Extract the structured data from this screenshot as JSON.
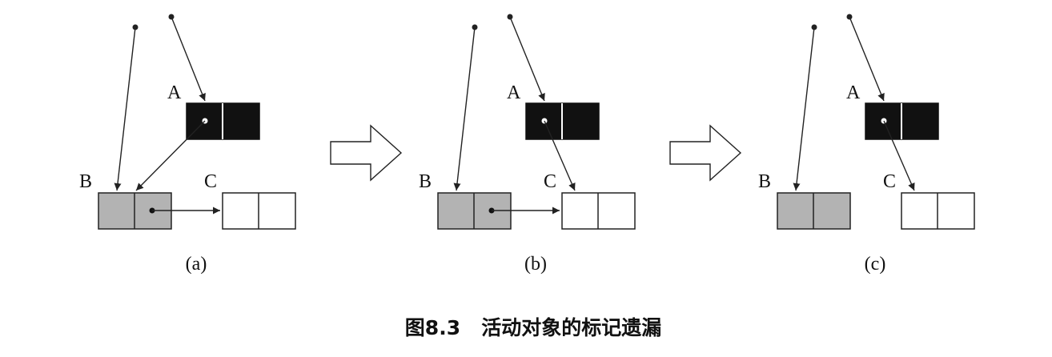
{
  "colors": {
    "black_object": "#111111",
    "marked_object": "#b3b3b3",
    "white_object": "#ffffff",
    "stroke": "#222222"
  },
  "panels": [
    {
      "id": "a",
      "sublabel": "(a)",
      "labels": {
        "A": "A",
        "B": "B",
        "C": "C"
      },
      "pointers": [
        "root-to-A",
        "root-to-B",
        "A-to-B",
        "B-to-C"
      ]
    },
    {
      "id": "b",
      "sublabel": "(b)",
      "labels": {
        "A": "A",
        "B": "B",
        "C": "C"
      },
      "pointers": [
        "root-to-A",
        "root-to-B",
        "A-to-C",
        "B-to-C"
      ]
    },
    {
      "id": "c",
      "sublabel": "(c)",
      "labels": {
        "A": "A",
        "B": "B",
        "C": "C"
      },
      "pointers": [
        "root-to-A",
        "root-to-B",
        "A-to-C"
      ]
    }
  ],
  "transition_icon": "hollow-right-arrow",
  "caption": "图8.3   活动对象的标记遗漏"
}
